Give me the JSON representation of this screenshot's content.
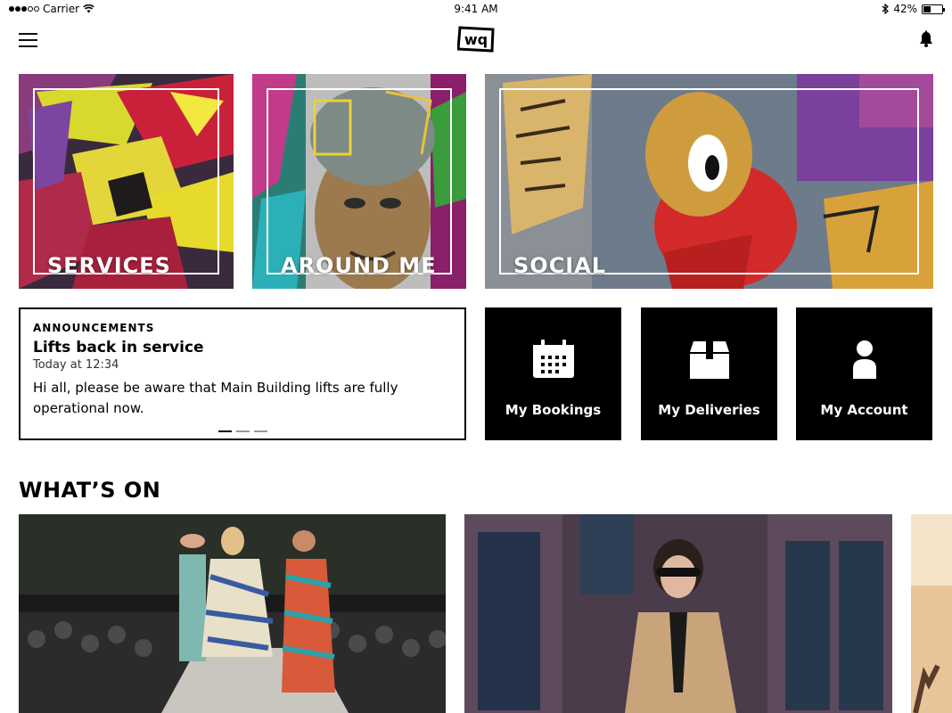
{
  "status_bar": {
    "carrier": "Carrier",
    "time": "9:41 AM",
    "battery_percent": "42%",
    "battery_level": 0.42
  },
  "nav": {
    "logo_text": "wq",
    "menu_icon": "hamburger-icon",
    "bell_icon": "bell-icon"
  },
  "tiles": [
    {
      "label": "SERVICES"
    },
    {
      "label": "AROUND ME"
    },
    {
      "label": "SOCIAL"
    }
  ],
  "announcements": {
    "kicker": "ANNOUNCEMENTS",
    "title": "Lifts back in service",
    "time": "Today at 12:34",
    "body": "Hi all, please be aware that Main Building lifts are fully operational now.",
    "pages": 3,
    "active_page": 0
  },
  "actions": [
    {
      "label": "My Bookings",
      "icon": "calendar-icon"
    },
    {
      "label": "My Deliveries",
      "icon": "package-icon"
    },
    {
      "label": "My Account",
      "icon": "user-icon"
    }
  ],
  "whats_on": {
    "title": "WHAT’S ON"
  }
}
